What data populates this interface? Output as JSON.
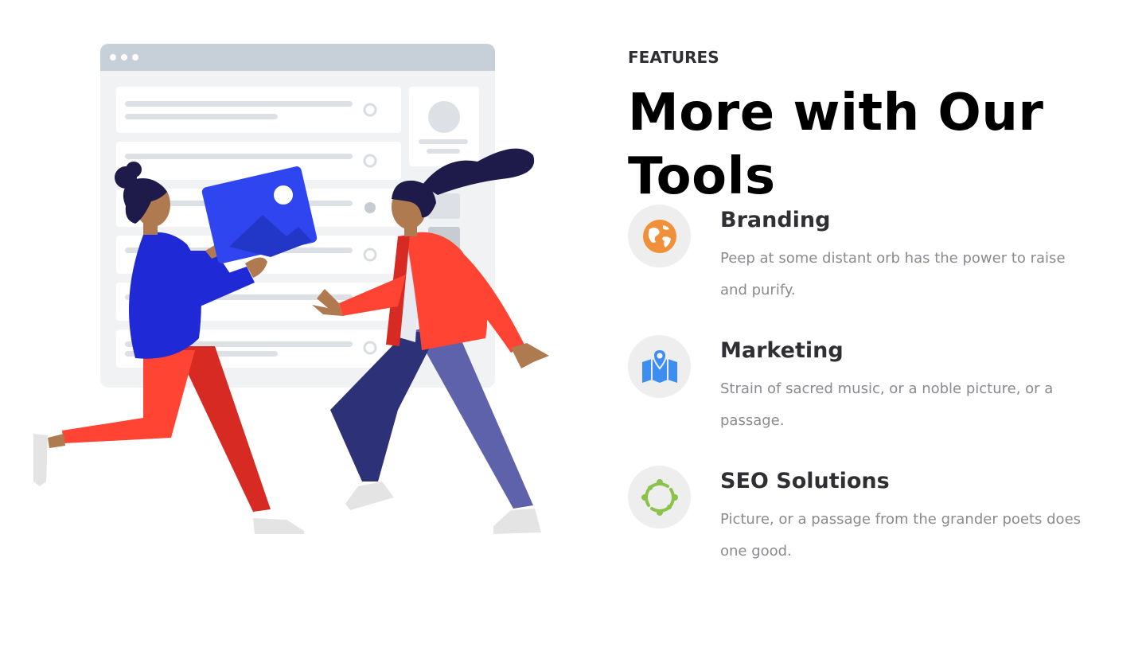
{
  "section": {
    "eyebrow": "FEATURES",
    "title_line1": "More with Our",
    "title_line2": "Tools"
  },
  "features": [
    {
      "heading": "Branding",
      "text": "Peep at some distant orb has the power to raise and purify.",
      "icon": "globe-icon",
      "icon_color": "#f0903a"
    },
    {
      "heading": "Marketing",
      "text": "Strain of sacred music, or a noble picture, or a passage.",
      "icon": "map-pin-icon",
      "icon_color": "#3d8ef0"
    },
    {
      "heading": "SEO Solutions",
      "text": "Picture, or a passage from the grander poets does one good.",
      "icon": "network-cycle-icon",
      "icon_color": "#8bc34a"
    }
  ],
  "illustration": {
    "name": "team-collaboration-illustration",
    "colors": {
      "browser_frame": "#c7d0d8",
      "browser_body": "#eef0f3",
      "image_card": "#2f45f0",
      "skin": "#b07a50",
      "hair": "#1e1a4a",
      "left_shirt": "#1f2ad6",
      "left_pants": "#ff4433",
      "right_jacket": "#ff4433",
      "right_pants_dark": "#2d3278",
      "right_pants_light": "#5d62aa"
    }
  }
}
